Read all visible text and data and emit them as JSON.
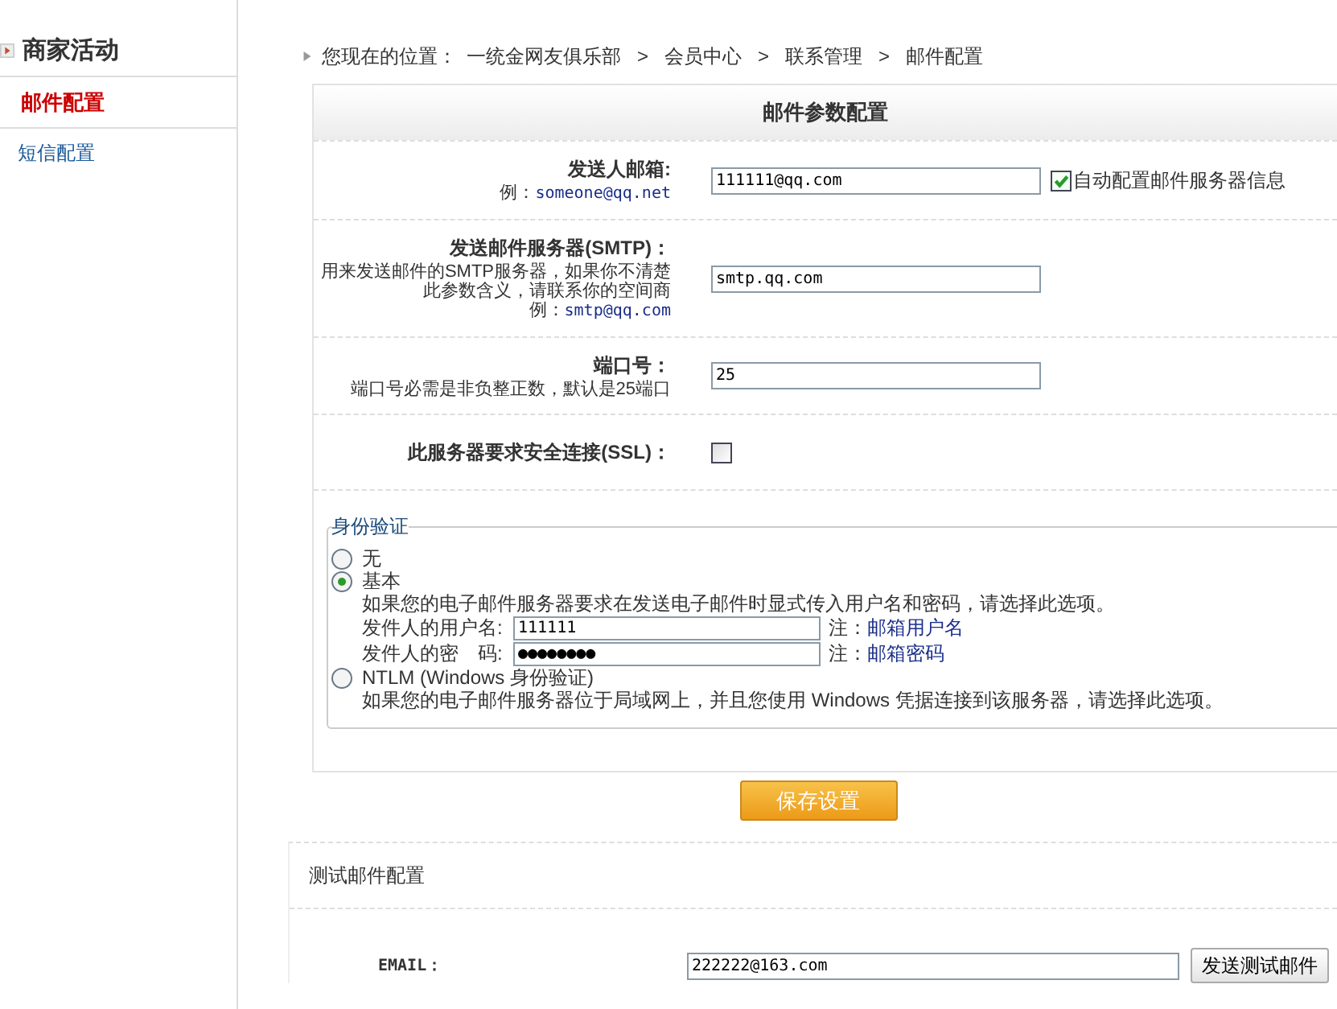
{
  "sidebar": {
    "title": "商家活动",
    "items": [
      {
        "label": "邮件配置",
        "selected": true
      },
      {
        "label": "短信配置",
        "selected": false
      }
    ]
  },
  "breadcrumb": {
    "prefix": "您现在的位置：",
    "separator": ">",
    "items": [
      "一统金网友俱乐部",
      "会员中心",
      "联系管理",
      "邮件配置"
    ]
  },
  "mail_config": {
    "title": "邮件参数配置",
    "fields": [
      {
        "kind": "text",
        "label": "发送人邮箱:",
        "note_prefix": "例：",
        "note_example": "someone@qq.net",
        "value": "111111@qq.com",
        "option": {
          "label": "自动配置邮件服务器信息",
          "checked": true
        }
      },
      {
        "kind": "text",
        "label": "发送邮件服务器(SMTP)：",
        "note": "用来发送邮件的SMTP服务器，如果你不清楚此参数含义，请联系你的空间商",
        "note_prefix": "例：",
        "note_example": "smtp@qq.com",
        "value": "smtp.qq.com"
      },
      {
        "kind": "text",
        "label": "端口号：",
        "note": "端口号必需是非负整正数，默认是25端口",
        "value": "25"
      },
      {
        "kind": "checkbox",
        "label": "此服务器要求安全连接(SSL)：",
        "checked": false
      }
    ]
  },
  "auth": {
    "legend": "身份验证",
    "options": [
      {
        "label": "无",
        "selected": false
      },
      {
        "label": "基本",
        "selected": true,
        "description": "如果您的电子邮件服务器要求在发送电子邮件时显式传入用户名和密码，请选择此选项。",
        "fields": [
          {
            "label": "发件人的用户名:",
            "value": "111111",
            "note_prefix": "注：",
            "note_link": "邮箱用户名"
          },
          {
            "label": "发件人的密　码:",
            "value": "●●●●●●●●",
            "note_prefix": "注：",
            "note_link": "邮箱密码"
          }
        ]
      },
      {
        "label": "NTLM (Windows 身份验证)",
        "selected": false,
        "description": "如果您的电子邮件服务器位于局域网上，并且您使用 Windows 凭据连接到该服务器，请选择此选项。"
      }
    ]
  },
  "save_button": "保存设置",
  "test": {
    "title": "测试邮件配置",
    "label": "EMAIL：",
    "value": "222222@163.com",
    "button": "发送测试邮件"
  }
}
